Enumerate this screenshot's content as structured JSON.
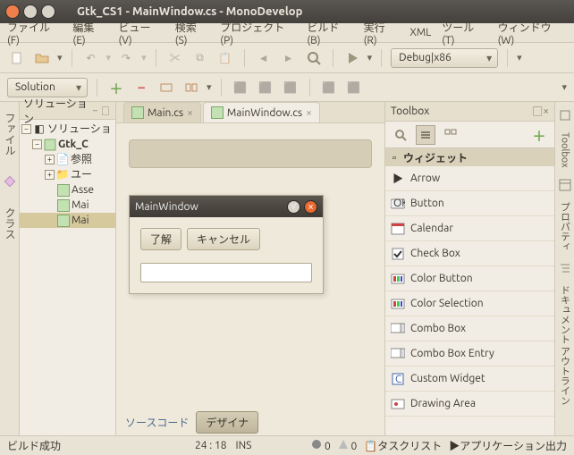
{
  "window": {
    "title": "Gtk_CS1 - MainWindow.cs - MonoDevelop"
  },
  "menu": [
    "ファイル (F)",
    "編集 (E)",
    "ビュー (V)",
    "検索 (S)",
    "プロジェクト (P)",
    "ビルド (B)",
    "実行 (R)",
    "XML",
    "ツール (T)",
    "ウィンドウ (W)"
  ],
  "toolbar": {
    "config": "Debug|x86"
  },
  "solution_combo": "Solution",
  "solution_panel": {
    "title": "ソリューション",
    "nodes": {
      "root": "ソリューショ",
      "project": "Gtk_C",
      "refs": "参照",
      "userint": "ユー",
      "asm": "Asse",
      "main": "Mai",
      "mainwin": "Mai"
    }
  },
  "left_tabs": [
    "ファイル",
    "クラス"
  ],
  "editor": {
    "tabs": [
      {
        "label": "Main.cs",
        "active": false
      },
      {
        "label": "MainWindow.cs",
        "active": true
      }
    ],
    "form": {
      "title": "MainWindow",
      "ok": "了解",
      "cancel": "キャンセル",
      "entry_value": ""
    },
    "view_source": "ソースコード",
    "view_design": "デザイナ"
  },
  "toolbox": {
    "title": "Toolbox",
    "group": "ウィジェット",
    "items": [
      "Arrow",
      "Button",
      "Calendar",
      "Check Box",
      "Color Button",
      "Color Selection",
      "Combo Box",
      "Combo Box Entry",
      "Custom Widget",
      "Drawing Area"
    ]
  },
  "right_tabs": [
    "Toolbox",
    "プロパティ",
    "ドキュメント アウトライン"
  ],
  "status": {
    "build": "ビルド成功",
    "pos": "24 : 18",
    "ins": "INS",
    "err": "0",
    "warn": "0",
    "tasklist": "タスクリスト",
    "appout": "アプリケーション出力"
  }
}
